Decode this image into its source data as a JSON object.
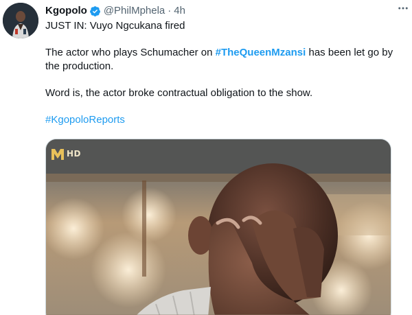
{
  "tweet": {
    "author": {
      "display_name": "Kgopolo",
      "handle": "@PhilMphela",
      "separator": "·",
      "time": "4h",
      "verified": true
    },
    "text": {
      "line1": "JUST IN: Vuyo Ngcukana fired",
      "p2_before": "The actor who plays Schumacher on ",
      "p2_hashtag": "#TheQueenMzansi",
      "p2_after": " has been let go by the production.",
      "p3": "Word is, the actor broke contractual obligation to the show.",
      "p4_hashtag": "#KgopoloReports"
    },
    "media": {
      "channel_badge": "HD"
    },
    "icons": {
      "more": "more-horizontal-icon",
      "verified": "verified-badge-icon"
    },
    "colors": {
      "link": "#1d9bf0",
      "secondary_text": "#536471",
      "verified": "#1d9bf0"
    }
  }
}
